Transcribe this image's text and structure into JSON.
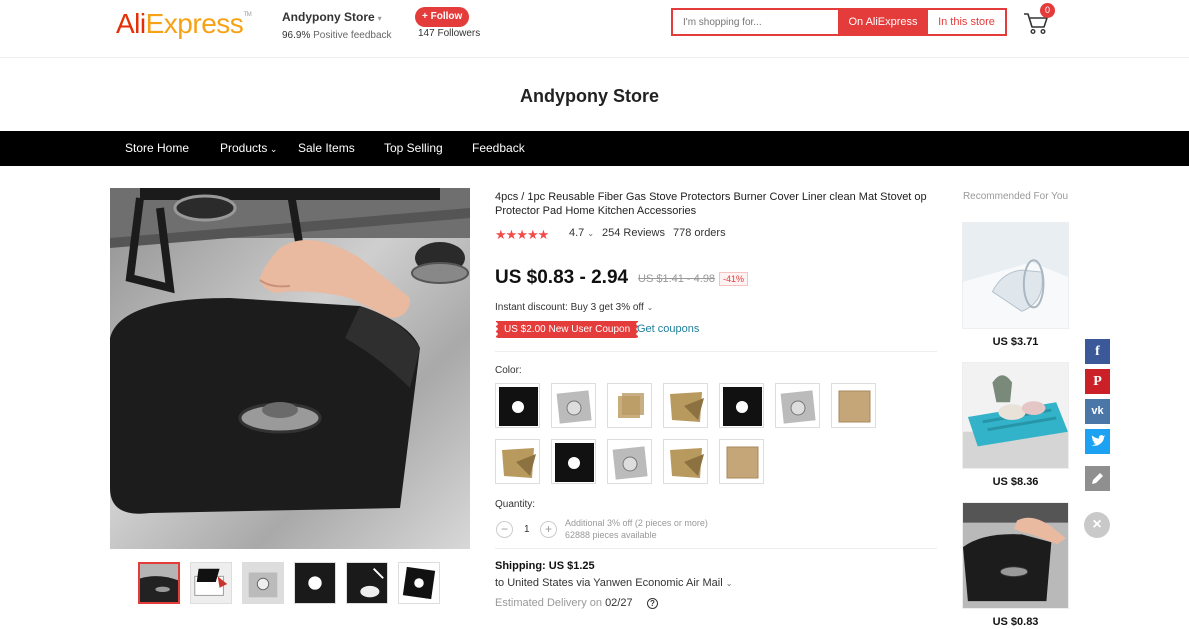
{
  "header": {
    "logo_part1": "Ali",
    "logo_part2": "Express",
    "logo_tm": "TM",
    "store_name": "Andypony Store",
    "positive_value": "96.9%",
    "positive_label": "Positive feedback",
    "follow_label": "+ Follow",
    "followers": "147 Followers",
    "search_placeholder": "I'm shopping for...",
    "search_btn_ae": "On AliExpress",
    "search_btn_store": "In this store",
    "cart_count": "0",
    "colors": {
      "accent": "#e43b3b",
      "logo_red": "#e62e04",
      "logo_orange": "#f7a215"
    }
  },
  "store_title": "Andypony Store",
  "nav": {
    "items": [
      "Store Home",
      "Products",
      "Sale Items",
      "Top Selling",
      "Feedback"
    ]
  },
  "product": {
    "title": "4pcs / 1pc Reusable Fiber Gas Stove Protectors Burner Cover Liner clean Mat Stovet op Protector Pad Home Kitchen Accessories",
    "stars": "★★★★★",
    "rating": "4.7",
    "reviews": "254 Reviews",
    "orders": "778 orders",
    "price": "US $0.83 - 2.94",
    "old_price": "US $1.41 - 4.98",
    "discount": "-41%",
    "instant_discount": "Instant discount: Buy 3 get 3% off",
    "coupon": "US $2.00 New User Coupon",
    "get_coupons": "Get coupons",
    "color_label": "Color:",
    "quantity_label": "Quantity:",
    "quantity": "1",
    "qty_note1": "Additional 3% off (2 pieces or more)",
    "qty_note2": "62888 pieces available",
    "shipping_label": "Shipping: US $1.25",
    "ship_to": "to United States via Yanwen Economic Air Mail",
    "delivery_label": "Estimated Delivery on",
    "delivery_date": "02/27"
  },
  "recommended": {
    "title": "Recommended For You",
    "items": [
      {
        "price": "US $3.71"
      },
      {
        "price": "US $8.36"
      },
      {
        "price": "US $0.83"
      }
    ]
  }
}
